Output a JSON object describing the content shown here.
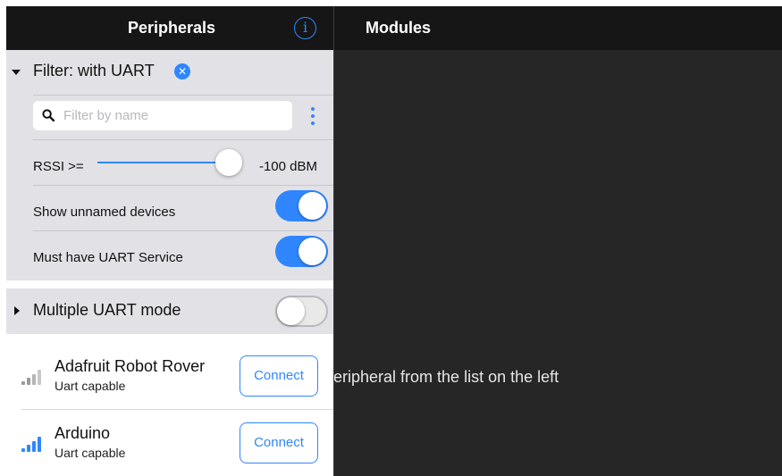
{
  "peripherals": {
    "title": "Peripherals",
    "info_icon_glyph": "i",
    "filter": {
      "title": "Filter: with UART",
      "search": {
        "placeholder": "Filter by name",
        "value": ""
      },
      "rssi": {
        "label": "RSSI >=",
        "value_text": "-100 dBM",
        "slider_level": 1.0
      },
      "show_unnamed": {
        "label": "Show unnamed devices",
        "on": true
      },
      "must_have_uart": {
        "label": "Must have UART Service",
        "on": true
      }
    },
    "multiple_uart": {
      "label": "Multiple UART mode",
      "on": false
    },
    "devices": [
      {
        "name": "Adafruit Robot Rover",
        "subtitle": "Uart capable",
        "signal_bars": 2,
        "connect_label": "Connect"
      },
      {
        "name": "Arduino",
        "subtitle": "Uart capable",
        "signal_bars": 4,
        "connect_label": "Connect"
      }
    ]
  },
  "modules": {
    "title": "Modules",
    "hint": "eripheral from the list on the left"
  },
  "colors": {
    "accent": "#2f86ff",
    "header_bg": "#161616",
    "detail_bg": "#262626",
    "filter_bg": "#e2e2e6"
  }
}
